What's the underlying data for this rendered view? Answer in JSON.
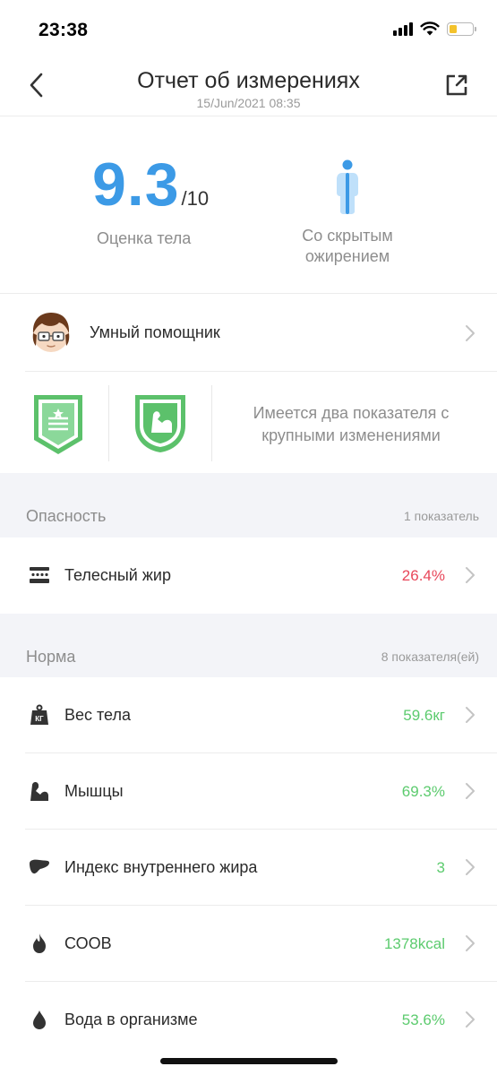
{
  "status_bar": {
    "time": "23:38"
  },
  "header": {
    "title": "Отчет об измерениях",
    "subtitle": "15/Jun/2021 08:35"
  },
  "score": {
    "value": "9.3",
    "max": "/10",
    "label": "Оценка тела"
  },
  "body_type": {
    "label_line1": "Со скрытым",
    "label_line2": "ожирением"
  },
  "assistant": {
    "label": "Умный помощник"
  },
  "badges": {
    "text_line1": "Имеется два показателя с",
    "text_line2": "крупными изменениями"
  },
  "sections": {
    "danger": {
      "title": "Опасность",
      "count": "1 показатель"
    },
    "normal": {
      "title": "Норма",
      "count": "8 показателя(ей)"
    }
  },
  "danger_metrics": [
    {
      "label": "Телесный жир",
      "value": "26.4%",
      "icon": "body-fat-icon"
    }
  ],
  "normal_metrics": [
    {
      "label": "Вес тела",
      "value": "59.6кг",
      "icon": "weight-icon"
    },
    {
      "label": "Мышцы",
      "value": "69.3%",
      "icon": "muscle-icon"
    },
    {
      "label": "Индекс внутреннего жира",
      "value": "3",
      "icon": "visceral-fat-icon"
    },
    {
      "label": "СООВ",
      "value": "1378kcal",
      "icon": "metabolism-icon"
    },
    {
      "label": "Вода в организме",
      "value": "53.6%",
      "icon": "water-icon"
    }
  ],
  "colors": {
    "accent_blue": "#3c9ae6",
    "danger_red": "#e8475a",
    "normal_green": "#5ccb6e",
    "badge_green": "#5cc16b",
    "section_bg": "#f3f4f8"
  }
}
